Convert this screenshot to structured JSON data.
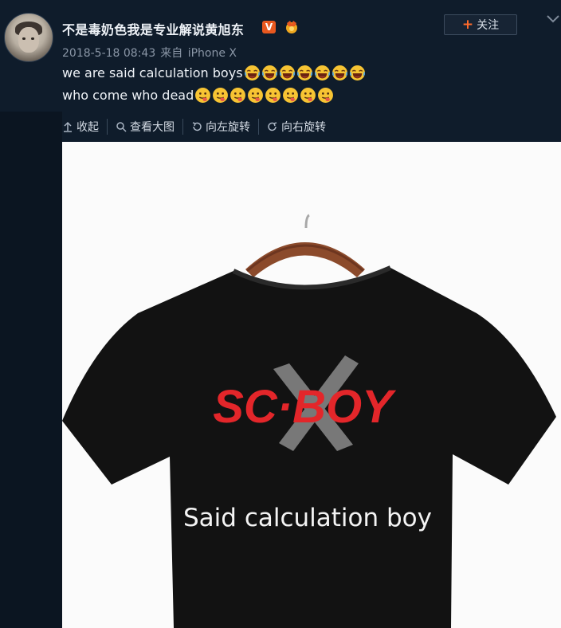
{
  "post": {
    "author": "不是毒奶色我是专业解说黄旭东",
    "verified_badge": "V",
    "date": "2018-5-18 08:43",
    "source_prefix": "来自",
    "device": "iPhone X",
    "text_line1": "we are said calculation boys",
    "text_line2": "who come who dead",
    "emoji_line1": "laughing-crying-emoji",
    "emoji_line2": "tongue-out-emoji",
    "emoji_line1_count": 7,
    "emoji_line2_count": 8
  },
  "follow": {
    "label": "关注"
  },
  "toolbar": {
    "collapse": "收起",
    "view_large": "查看大图",
    "rotate_left": "向左旋转",
    "rotate_right": "向右旋转"
  },
  "image": {
    "logo_text": "SC·BOY",
    "shirt_text": "Said calculation boy"
  },
  "colors": {
    "background": "#0f1c2b",
    "accent": "#ff6a2b",
    "logo_red": "#e3262a",
    "shirt": "#121212"
  }
}
